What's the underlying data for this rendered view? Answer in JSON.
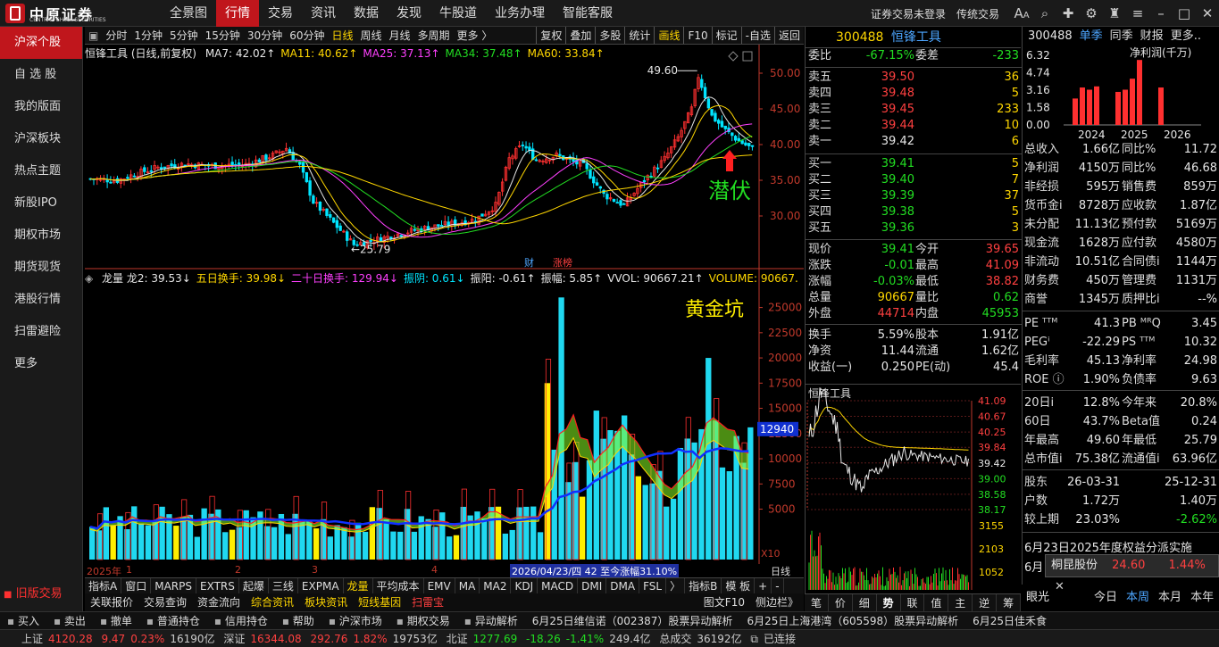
{
  "app": {
    "logo_cn": "中原证券",
    "logo_en": "CENTRAL CHINA SECURITIES"
  },
  "nav": {
    "items": [
      "全景图",
      "行情",
      "交易",
      "资讯",
      "数据",
      "发现",
      "牛股道",
      "业务办理",
      "智能客服"
    ],
    "active": 1
  },
  "topright": {
    "login": "证券交易未登录",
    "trade": "传统交易"
  },
  "sidebar": {
    "items": [
      "沪深个股",
      "自 选 股",
      "我的版面",
      "沪深板块",
      "热点主题",
      "新股IPO",
      "期权市场",
      "期货现货",
      "港股行情",
      "扫雷避险",
      "更多"
    ],
    "active": 0,
    "old_version": "旧版交易"
  },
  "chart_toolbar": {
    "left": [
      "分时",
      "1分钟",
      "5分钟",
      "15分钟",
      "30分钟",
      "60分钟",
      "日线",
      "周线",
      "月线",
      "多周期",
      "更多 〉"
    ],
    "right": [
      "复权",
      "叠加",
      "多股",
      "统计",
      "画线",
      "F10",
      "标记",
      "-自选",
      "返回"
    ]
  },
  "main_chart": {
    "name": "恒锋工具 (日线,前复权)",
    "ma": [
      {
        "label": "MA7: 42.02↑",
        "color": "#e6e6e6"
      },
      {
        "label": "MA11: 40.62↑",
        "color": "#ffd700"
      },
      {
        "label": "MA25: 37.13↑",
        "color": "#ff40ff"
      },
      {
        "label": "MA34: 37.48↑",
        "color": "#22dd22"
      },
      {
        "label": "MA60: 33.84↑",
        "color": "#ffd700"
      }
    ],
    "annotation_high": "49.60",
    "annotation_low": "25.79",
    "annotation_text": "潜伏",
    "tag_fin": "财",
    "tag_limit": "涨榜",
    "y_ticks": [
      "50.00",
      "45.00",
      "40.00",
      "35.00",
      "30.00"
    ]
  },
  "sub_chart": {
    "items": [
      {
        "label": "龙量  龙2: 39.53↓",
        "color": "#e6e6e6"
      },
      {
        "label": "五日换手: 39.98↓",
        "color": "#ffd700"
      },
      {
        "label": "二十日换手: 129.94↓",
        "color": "#ff40ff"
      },
      {
        "label": "振阴: 0.61↓",
        "color": "#00e5ff"
      },
      {
        "label": "振阳: -0.61↑",
        "color": "#e6e6e6"
      },
      {
        "label": "振幅: 5.85↑",
        "color": "#e6e6e6"
      },
      {
        "label": "VVOL: 90667.21↑",
        "color": "#e6e6e6"
      },
      {
        "label": "VOLUME: 90667.",
        "color": "#ffd700"
      }
    ],
    "annotation_text": "黄金坑",
    "current_tag": "12940",
    "y_ticks": [
      "25000",
      "22500",
      "20000",
      "17500",
      "15000",
      "12500",
      "10000",
      "7500",
      "5000"
    ],
    "unit": "X10"
  },
  "datebar": {
    "year": "2025年",
    "months": [
      "1",
      "2",
      "3",
      "4"
    ],
    "tooltip": "2026/04/23/四 42 至今涨幅31.10%",
    "period": "日线"
  },
  "indicator_tabs": [
    "指标A",
    "窗口",
    "MARPS",
    "EXTRS",
    "起爆",
    "三线",
    "EXPMA",
    "龙量",
    "平均成本",
    "EMV",
    "MA",
    "MA2",
    "KDJ",
    "MACD",
    "DMI",
    "DMA",
    "FSL",
    "〉",
    "指标B",
    "模  板",
    "+",
    "-"
  ],
  "link_bar": [
    "关联报价",
    "交易查询",
    "资金流向",
    "综合资讯",
    "板块资讯",
    "短线基因",
    "扫雷宝",
    "图文F10",
    "侧边栏》"
  ],
  "quote": {
    "code": "300488",
    "name": "恒锋工具",
    "weibi": {
      "label": "委比",
      "value": "-67.15%",
      "label2": "委差",
      "value2": "-233"
    },
    "asks": [
      {
        "label": "卖五",
        "price": "39.50",
        "vol": "36"
      },
      {
        "label": "卖四",
        "price": "39.48",
        "vol": "5"
      },
      {
        "label": "卖三",
        "price": "39.45",
        "vol": "233"
      },
      {
        "label": "卖二",
        "price": "39.44",
        "vol": "10"
      },
      {
        "label": "卖一",
        "price": "39.42",
        "vol": "6"
      }
    ],
    "bids": [
      {
        "label": "买一",
        "price": "39.41",
        "vol": "5"
      },
      {
        "label": "买二",
        "price": "39.40",
        "vol": "7"
      },
      {
        "label": "买三",
        "price": "39.39",
        "vol": "37"
      },
      {
        "label": "买四",
        "price": "39.38",
        "vol": "5"
      },
      {
        "label": "买五",
        "price": "39.36",
        "vol": "3"
      }
    ],
    "stats": [
      {
        "l": "现价",
        "v": "39.41",
        "l2": "今开",
        "v2": "39.65"
      },
      {
        "l": "涨跌",
        "v": "-0.01",
        "l2": "最高",
        "v2": "41.09"
      },
      {
        "l": "涨幅",
        "v": "-0.03%",
        "l2": "最低",
        "v2": "38.82"
      },
      {
        "l": "总量",
        "v": "90667",
        "l2": "量比",
        "v2": "0.62"
      },
      {
        "l": "外盘",
        "v": "44714",
        "l2": "内盘",
        "v2": "45953"
      }
    ],
    "stats2": [
      {
        "l": "换手",
        "v": "5.59%",
        "l2": "股本",
        "v2": "1.91亿"
      },
      {
        "l": "净资",
        "v": "11.44",
        "l2": "流通",
        "v2": "1.62亿"
      },
      {
        "l": "收益(一)",
        "v": "0.250",
        "l2": "PE(动)",
        "v2": "45.4"
      }
    ]
  },
  "mini_chart": {
    "title": "恒锋工具",
    "prices": [
      "41.09",
      "40.67",
      "40.25",
      "39.84",
      "39.42",
      "39.00",
      "38.58",
      "38.17"
    ],
    "vols": [
      "3155",
      "2103",
      "1052"
    ]
  },
  "mini_tabs": [
    "笔",
    "价",
    "细",
    "势",
    "联",
    "值",
    "主",
    "逆",
    "筹"
  ],
  "finance": {
    "code": "300488",
    "tabs": [
      "单季",
      "同季",
      "财报",
      "更多.."
    ],
    "chart_label": "净利润(千万)",
    "chart_y": [
      "6.32",
      "4.74",
      "3.16",
      "1.58",
      "0.00"
    ],
    "chart_x": [
      "2024",
      "2025",
      "2026"
    ],
    "rows": [
      [
        "总收入",
        "1.66亿",
        "同比%",
        "11.72"
      ],
      [
        "净利润",
        "4150万",
        "同比%",
        "46.68"
      ],
      [
        "非经损",
        "595万",
        "销售费",
        "859万"
      ],
      [
        "货币金i",
        "8728万",
        "应收款",
        "1.87亿"
      ],
      [
        "未分配",
        "11.13亿",
        "预付款",
        "5169万"
      ],
      [
        "现金流",
        "1628万",
        "应付款",
        "4580万"
      ],
      [
        "非流动",
        "10.51亿",
        "合同债i",
        "1144万"
      ],
      [
        "财务费",
        "450万",
        "管理费",
        "1131万"
      ],
      [
        "商誉",
        "1345万",
        "质押比i",
        "--%"
      ]
    ],
    "rows2": [
      [
        "PE ᵀᵀᴹ",
        "41.3",
        "PB ᴹᴿQ",
        "3.45"
      ],
      [
        "PEGⁱ",
        "-22.29",
        "PS ᵀᵀᴹ",
        "10.32"
      ],
      [
        "毛利率",
        "45.13",
        "净利率",
        "24.98"
      ],
      [
        "ROE ⓘ",
        "1.90%",
        "负债率",
        "9.63"
      ]
    ],
    "rows3": [
      [
        "20日i",
        "12.8%",
        "今年来",
        "20.8%"
      ],
      [
        "60日",
        "43.7%",
        "Beta值",
        "0.24"
      ],
      [
        "年最高",
        "49.60",
        "年最低",
        "25.79"
      ],
      [
        "总市值i",
        "75.38亿",
        "流通值i",
        "63.96亿"
      ]
    ],
    "rows4": [
      [
        "股东",
        "26-03-31",
        "",
        "25-12-31"
      ],
      [
        "户数",
        "1.72万",
        "",
        "1.40万"
      ],
      [
        "较上期",
        "23.03%",
        "",
        "-2.62%"
      ]
    ],
    "notice": "6月23日2025年度权益分派实施",
    "notice2": "6月",
    "popup": {
      "name": "桐昆股份",
      "price": "24.60",
      "pct": "1.44%"
    },
    "look": {
      "title": "眼光",
      "tabs": [
        "今日",
        "本周",
        "本月",
        "本年"
      ],
      "active": 1
    }
  },
  "actbar": [
    "买入",
    "卖出",
    "撤单",
    "普通持仓",
    "信用持仓",
    "帮助",
    "沪深市场",
    "期权交易",
    "异动解析",
    "6月25日维信诺（002387）股票异动解析",
    "6月25日上海港湾（605598）股票异动解析",
    "6月25日佳禾食"
  ],
  "status": {
    "sh_label": "上证",
    "sh": "4120.28",
    "sh_chg": "9.47",
    "sh_pct": "0.23%",
    "sh_amt": "16190亿",
    "sz_label": "深证",
    "sz": "16344.08",
    "sz_chg": "292.76",
    "sz_pct": "1.82%",
    "sz_amt": "19753亿",
    "bz_label": "北证",
    "bz": "1277.69",
    "bz_chg": "-18.26",
    "bz_pct": "-1.41%",
    "bz_amt": "249.4亿",
    "deal_label": "总成交",
    "deal": "36192亿",
    "conn": "已连接"
  }
}
